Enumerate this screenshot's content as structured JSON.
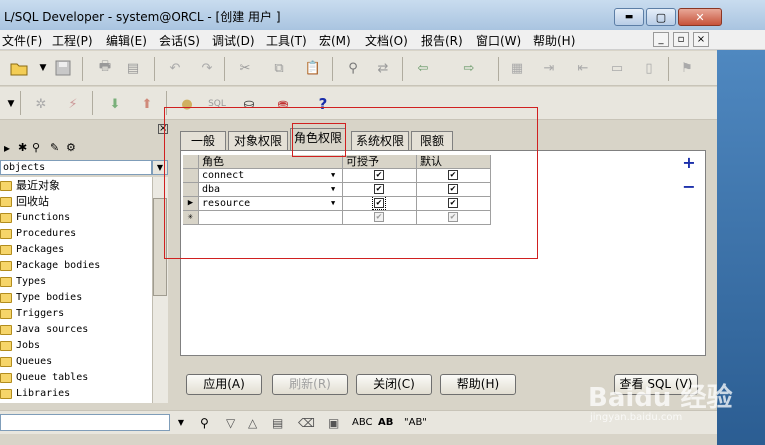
{
  "window": {
    "title": "L/SQL Developer - system@ORCL - [创建 用户 ]",
    "minimize_glyph": "▬",
    "maximize_glyph": "▢",
    "close_glyph": "✕"
  },
  "menu": {
    "items": [
      "文件(F)",
      "工程(P)",
      "编辑(E)",
      "会话(S)",
      "调试(D)",
      "工具(T)",
      "宏(M)",
      "文档(O)",
      "报告(R)",
      "窗口(W)",
      "帮助(H)"
    ],
    "mdi_min": "_",
    "mdi_restore": "▫",
    "mdi_close": "×"
  },
  "toolbar": {
    "icons": [
      "open-folder",
      "dropdown-arrow",
      "save",
      "print",
      "print-preview",
      "undo",
      "redo",
      "cut",
      "copy",
      "paste",
      "find",
      "find-replace",
      "back",
      "forward",
      "compile",
      "indent",
      "unindent",
      "comment",
      "uncomment",
      "filter"
    ]
  },
  "toolbar2": {
    "icons": [
      "dropdown-arrow",
      "gear",
      "breakpoint",
      "connect",
      "disconnect",
      "session",
      "sql-window",
      "commit",
      "rollback",
      "help"
    ],
    "help_glyph": "?"
  },
  "browser": {
    "combo_value": "objects",
    "items": [
      "最近对象",
      "回收站",
      "Functions",
      "Procedures",
      "Packages",
      "Package bodies",
      "Types",
      "Type bodies",
      "Triggers",
      "Java sources",
      "Jobs",
      "Queues",
      "Queue tables",
      "Libraries"
    ]
  },
  "tabs": {
    "items": [
      "一般",
      "对象权限",
      "角色权限",
      "系统权限",
      "限额"
    ],
    "active": "角色权限"
  },
  "grid": {
    "columns": [
      "角色",
      "可授予",
      "默认"
    ],
    "rows": [
      {
        "role": "connect",
        "grantable": true,
        "default": true
      },
      {
        "role": "dba",
        "grantable": true,
        "default": true
      },
      {
        "role": "resource",
        "grantable": true,
        "default": true
      }
    ],
    "current_row_marker": "▶",
    "new_row_marker": "✳"
  },
  "side_buttons": {
    "add": "+",
    "remove": "−"
  },
  "buttons": {
    "apply": "应用(A)",
    "refresh": "刷新(R)",
    "close": "关闭(C)",
    "help": "帮助(H)",
    "view_sql": "查看 SQL (V)"
  },
  "bottom_toolbar": {
    "labels": [
      "ABC",
      "AB",
      "\"AB\""
    ]
  },
  "watermark": {
    "text": "Baidu 经验",
    "url": "jingyan.baidu.com"
  },
  "colors": {
    "annotation_red": "#d02020",
    "accent_blue": "#1a2eaa"
  }
}
